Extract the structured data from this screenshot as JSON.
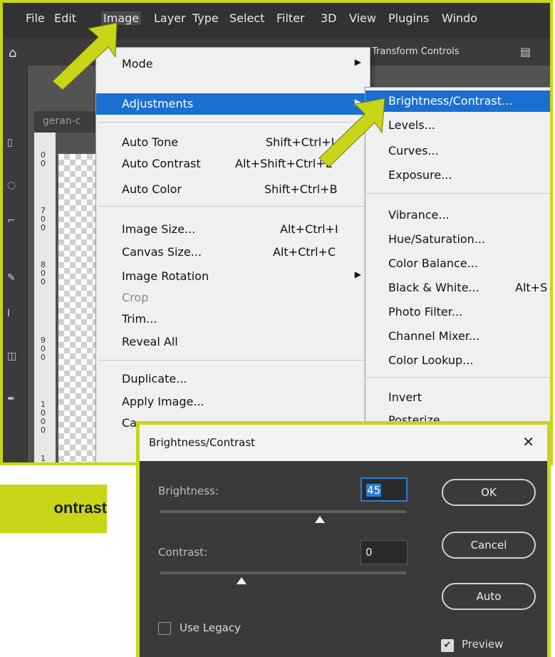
{
  "menubar": {
    "items": [
      "File",
      "Edit",
      "Image",
      "Layer",
      "Type",
      "Select",
      "Filter",
      "3D",
      "View",
      "Plugins",
      "Windo"
    ],
    "active_index": 2
  },
  "options_bar": {
    "transform_label": "Transform Controls"
  },
  "document": {
    "tab_label": "geran-c"
  },
  "ruler_digits": [
    "0",
    "0",
    "7",
    "0",
    "0",
    "8",
    "0",
    "0",
    "9",
    "0",
    "0",
    "1",
    "0",
    "0",
    "0",
    "1"
  ],
  "image_menu": {
    "items": [
      {
        "label": "Mode",
        "shortcut": "",
        "submenu": true
      },
      {
        "label": "Adjustments",
        "shortcut": "",
        "submenu": true,
        "selected": true
      },
      {
        "label": "Auto Tone",
        "shortcut": "Shift+Ctrl+L"
      },
      {
        "label": "Auto Contrast",
        "shortcut": "Alt+Shift+Ctrl+L"
      },
      {
        "label": "Auto Color",
        "shortcut": "Shift+Ctrl+B"
      },
      {
        "label": "Image Size...",
        "shortcut": "Alt+Ctrl+I"
      },
      {
        "label": "Canvas Size...",
        "shortcut": "Alt+Ctrl+C"
      },
      {
        "label": "Image Rotation",
        "shortcut": "",
        "submenu": true
      },
      {
        "label": "Crop",
        "shortcut": "",
        "disabled": true
      },
      {
        "label": "Trim...",
        "shortcut": ""
      },
      {
        "label": "Reveal All",
        "shortcut": ""
      },
      {
        "label": "Duplicate...",
        "shortcut": ""
      },
      {
        "label": "Apply Image...",
        "shortcut": ""
      },
      {
        "label": "Ca",
        "shortcut": ""
      }
    ]
  },
  "adjustments_menu": {
    "items": [
      {
        "label": "Brightness/Contrast...",
        "selected": true
      },
      {
        "label": "Levels..."
      },
      {
        "label": "Curves..."
      },
      {
        "label": "Exposure..."
      },
      {
        "label": "Vibrance..."
      },
      {
        "label": "Hue/Saturation..."
      },
      {
        "label": "Color Balance..."
      },
      {
        "label": "Black & White...",
        "shortcut": "Alt+S"
      },
      {
        "label": "Photo Filter..."
      },
      {
        "label": "Channel Mixer..."
      },
      {
        "label": "Color Lookup..."
      },
      {
        "label": "Invert"
      },
      {
        "label": "Posterize"
      }
    ]
  },
  "caption": {
    "text": "ontrast"
  },
  "dialog": {
    "title": "Brightness/Contrast",
    "close_glyph": "✕",
    "brightness_label": "Brightness:",
    "brightness_value": "45",
    "contrast_label": "Contrast:",
    "contrast_value": "0",
    "ok_label": "OK",
    "cancel_label": "Cancel",
    "auto_label": "Auto",
    "use_legacy_label": "Use Legacy",
    "use_legacy_checked": false,
    "preview_label": "Preview",
    "preview_checked": true,
    "check_glyph": "✔"
  },
  "colors": {
    "accent": "#c8d619",
    "menu_highlight": "#1a6fd1",
    "dialog_bg": "#3a3a3a"
  },
  "icons": [
    "home-icon",
    "align-icon",
    "submenu-arrow-icon",
    "close-icon",
    "checkbox-icon",
    "pointer-arrow-icon"
  ]
}
